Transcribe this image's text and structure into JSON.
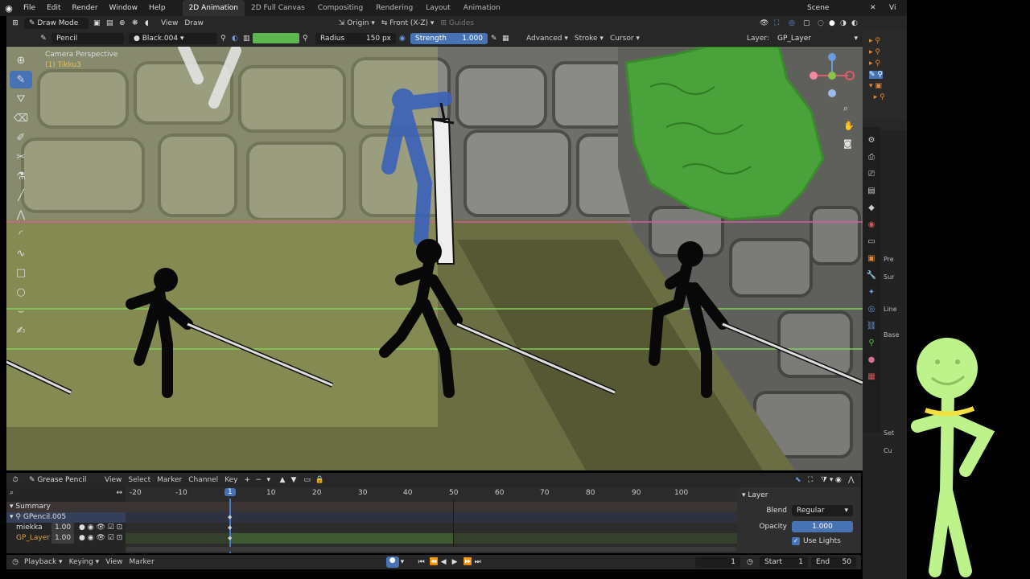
{
  "menubar": {
    "items": [
      "File",
      "Edit",
      "Render",
      "Window",
      "Help"
    ],
    "workspaces": [
      "2D Animation",
      "2D Full Canvas",
      "Compositing",
      "Rendering",
      "Layout",
      "Animation"
    ],
    "active_workspace": "2D Animation",
    "scene_label": "Scene",
    "viewlayer_label": "Vi"
  },
  "viewport_header": {
    "mode": "Draw Mode",
    "view_menu": "View",
    "draw_menu": "Draw",
    "origin": "Origin",
    "projection": "Front (X-Z)",
    "guides": "Guides"
  },
  "tool_header": {
    "brush": "Pencil",
    "material": "Black.004",
    "radius_label": "Radius",
    "radius_value": "150 px",
    "strength_label": "Strength",
    "strength_value": "1.000",
    "advanced": "Advanced",
    "stroke": "Stroke",
    "cursor": "Cursor",
    "layer_label": "Layer:",
    "layer_value": "GP_Layer",
    "color_accent": "#5cb84e"
  },
  "viewport": {
    "camera_label": "Camera Perspective",
    "object_label": "(1) Tikku3"
  },
  "dopesheet": {
    "editor": "Grease Pencil",
    "menus": [
      "View",
      "Select",
      "Marker",
      "Channel",
      "Key"
    ],
    "frame_ticks": [
      "-20",
      "-10",
      "1",
      "10",
      "20",
      "30",
      "40",
      "50",
      "60",
      "70",
      "80",
      "90",
      "100"
    ],
    "current_frame_marker": "1",
    "channels": {
      "summary": "Summary",
      "object": "GPencil.005",
      "layers": [
        {
          "name": "miekka",
          "value": "1.00"
        },
        {
          "name": "GP_Layer",
          "value": "1.00"
        }
      ]
    },
    "layer_panel": {
      "title": "Layer",
      "blend_label": "Blend",
      "blend_value": "Regular",
      "opacity_label": "Opacity",
      "opacity_value": "1.000",
      "use_lights": "Use Lights"
    }
  },
  "timeline": {
    "playback": "Playback",
    "keying": "Keying",
    "view": "View",
    "marker": "Marker",
    "current_frame": "1",
    "start_label": "Start",
    "start_value": "1",
    "end_label": "End",
    "end_value": "50"
  },
  "properties_strip": {
    "labels": [
      "Pre",
      "Sur",
      "Line",
      "Base",
      "Set",
      "Cu"
    ]
  }
}
